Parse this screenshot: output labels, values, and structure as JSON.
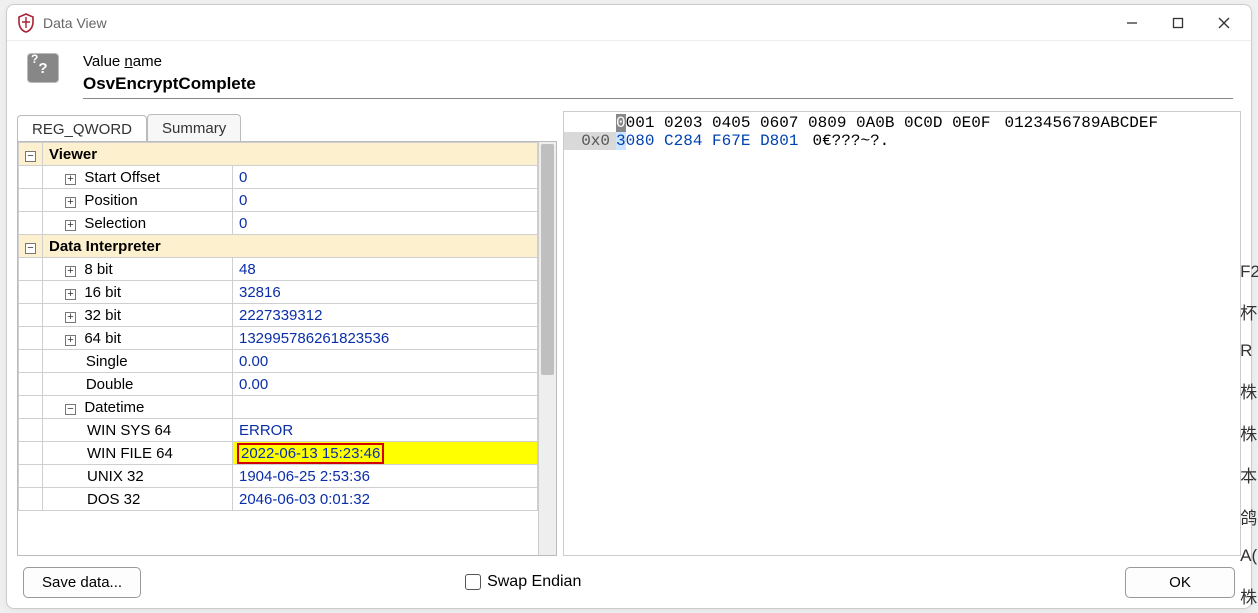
{
  "window": {
    "title": "Data View"
  },
  "header": {
    "label_prefix": "Value ",
    "label_underlined": "n",
    "label_suffix": "ame",
    "value_name": "OsvEncryptComplete"
  },
  "tabs": {
    "active": "REG_QWORD",
    "other": "Summary"
  },
  "tree": {
    "sections": {
      "viewer": "Viewer",
      "interpreter": "Data Interpreter"
    },
    "viewer_rows": [
      {
        "key": "Start Offset",
        "val": "0",
        "expand": "+"
      },
      {
        "key": "Position",
        "val": "0",
        "expand": "+"
      },
      {
        "key": "Selection",
        "val": "0",
        "expand": "+"
      }
    ],
    "interp_rows": [
      {
        "key": "8 bit",
        "val": "48",
        "expand": "+",
        "indent": 1
      },
      {
        "key": "16 bit",
        "val": "32816",
        "expand": "+",
        "indent": 1
      },
      {
        "key": "32 bit",
        "val": "2227339312",
        "expand": "+",
        "indent": 1
      },
      {
        "key": "64 bit",
        "val": "132995786261823536",
        "expand": "+",
        "indent": 1
      },
      {
        "key": "Single",
        "val": "0.00",
        "expand": "",
        "indent": 1
      },
      {
        "key": "Double",
        "val": "0.00",
        "expand": "",
        "indent": 1
      }
    ],
    "datetime_label": "Datetime",
    "datetime_rows": [
      {
        "key": "WIN SYS 64",
        "val": "ERROR"
      },
      {
        "key": "WIN FILE 64",
        "val": "2022-06-13 15:23:46",
        "highlight": true
      },
      {
        "key": "UNIX 32",
        "val": "1904-06-25 2:53:36"
      },
      {
        "key": "DOS 32",
        "val": "2046-06-03 0:01:32"
      }
    ]
  },
  "hex": {
    "header_cols": "0001 0203 0405 0607 0809 0A0B 0C0D 0E0F",
    "header_first": "0",
    "header_ascii": "0123456789ABCDEF",
    "offset": "0x0",
    "bytes": [
      "3080",
      "C284",
      "F67E",
      "D801"
    ],
    "ascii": "0€???~?."
  },
  "footer": {
    "save": "Save data...",
    "swap": "Swap Endian",
    "ok": "OK"
  },
  "edge_letters": [
    "F2",
    "杯",
    "R",
    "株",
    "株",
    "本",
    "鸽",
    "A(",
    "株"
  ]
}
